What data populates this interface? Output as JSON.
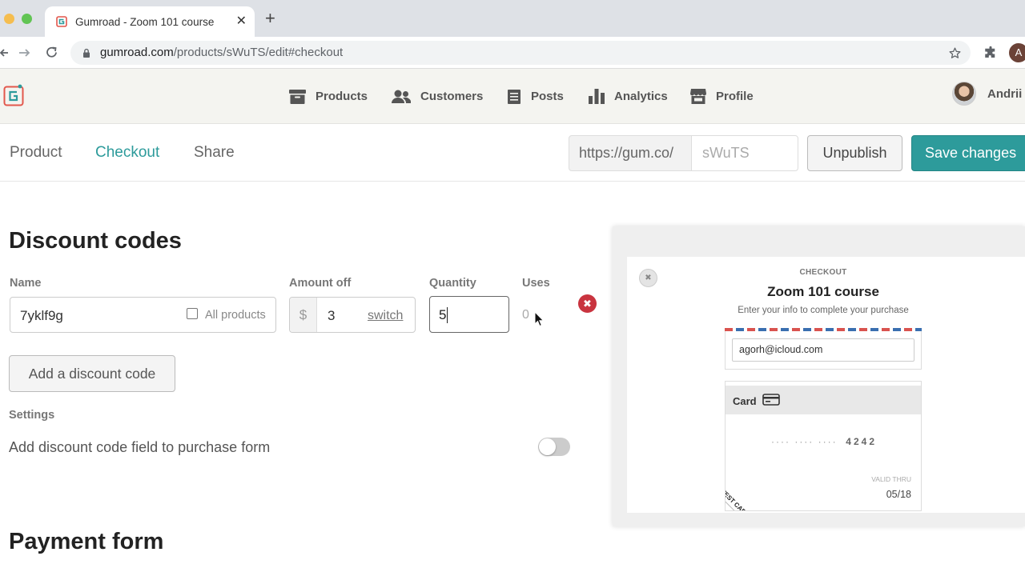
{
  "browser": {
    "tab_title": "Gumroad - Zoom 101 course",
    "url_host": "gumroad.com",
    "url_path": "/products/sWuTS/edit#checkout",
    "profile_initial": "A"
  },
  "nav": {
    "items": [
      {
        "label": "Products",
        "icon": "archive-icon"
      },
      {
        "label": "Customers",
        "icon": "users-icon"
      },
      {
        "label": "Posts",
        "icon": "document-icon"
      },
      {
        "label": "Analytics",
        "icon": "bar-chart-icon"
      },
      {
        "label": "Profile",
        "icon": "store-icon"
      }
    ],
    "user_name": "Andrii"
  },
  "subnav": {
    "tabs": [
      "Product",
      "Checkout",
      "Share"
    ],
    "active_tab": "Checkout",
    "url_prefix": "https://gum.co/",
    "slug_placeholder": "sWuTS",
    "unpublish_label": "Unpublish",
    "save_label": "Save changes"
  },
  "discount": {
    "heading": "Discount codes",
    "col_name": "Name",
    "col_amount": "Amount off",
    "col_quantity": "Quantity",
    "col_uses": "Uses",
    "code": {
      "name": "7yklf9g",
      "all_products_label": "All products",
      "currency": "$",
      "amount": "3",
      "switch_label": "switch",
      "quantity": "5",
      "uses": "0"
    },
    "add_button": "Add a discount code",
    "settings_label": "Settings",
    "setting_text": "Add discount code field to purchase form"
  },
  "payment": {
    "heading": "Payment form"
  },
  "preview": {
    "checkout_label": "CHECKOUT",
    "title": "Zoom 101 course",
    "subtitle": "Enter your info to complete your purchase",
    "email": "agorh@icloud.com",
    "card_label": "Card",
    "card_masked": "···· ···· ····",
    "card_last4": "4242",
    "valid_thru_label": "VALID THRU",
    "valid_thru": "05/18",
    "test_card_label": "TEST CARD"
  },
  "colors": {
    "accent": "#2d9b9b",
    "danger": "#c9343f"
  }
}
